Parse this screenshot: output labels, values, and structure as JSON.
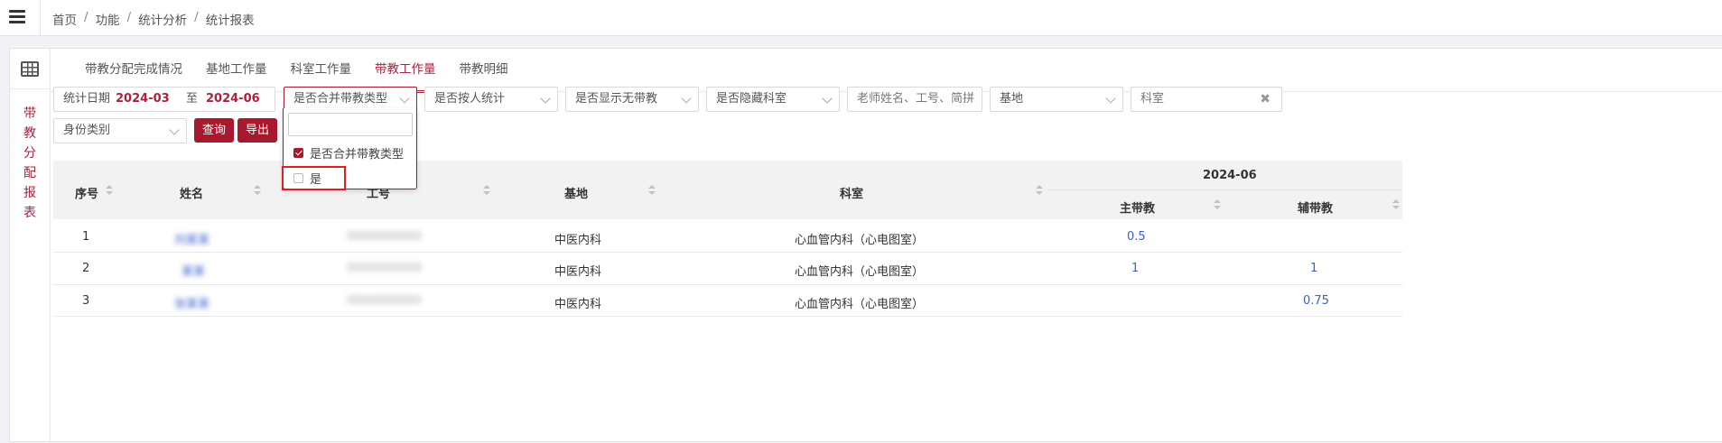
{
  "breadcrumb": [
    "首页",
    "功能",
    "统计分析",
    "统计报表"
  ],
  "sidebar_title": "带教分配报表",
  "tabs": [
    {
      "label": "带教分配完成情况",
      "active": false
    },
    {
      "label": "基地工作量",
      "active": false
    },
    {
      "label": "科室工作量",
      "active": false
    },
    {
      "label": "带教工作量",
      "active": true
    },
    {
      "label": "带教明细",
      "active": false
    }
  ],
  "filters": {
    "date_label": "统计日期",
    "date_from": "2024-03",
    "date_to_sep": "至",
    "date_to": "2024-06",
    "merge_type": "是否合并带教类型",
    "by_person": "是否按人统计",
    "show_none": "是否显示无带教",
    "hide_dept": "是否隐藏科室",
    "teacher_placeholder": "老师姓名、工号、简拼",
    "base": "基地",
    "dept": "科室",
    "identity": "身份类别",
    "clear_icon": "✖"
  },
  "buttons": {
    "query": "查询",
    "export": "导出"
  },
  "dropdown": {
    "search_value": "",
    "options": [
      {
        "label": "是否合并带教类型",
        "checked": true
      },
      {
        "label": "是",
        "checked": false
      }
    ]
  },
  "table": {
    "headers": {
      "seq": "序号",
      "name": "姓名",
      "id": "工号",
      "base": "基地",
      "dept": "科室",
      "period": "2024-06",
      "main": "主带教",
      "aux": "辅带教"
    },
    "rows": [
      {
        "seq": "1",
        "name": "刘某某",
        "id": "0000000000",
        "base": "中医内科",
        "dept": "心血管内科（心电图室）",
        "main": "0.5",
        "aux": ""
      },
      {
        "seq": "2",
        "name": "某某",
        "id": "0000000000",
        "base": "中医内科",
        "dept": "心血管内科（心电图室）",
        "main": "1",
        "aux": "1"
      },
      {
        "seq": "3",
        "name": "张某某",
        "id": "0000000000",
        "base": "中医内科",
        "dept": "心血管内科（心电图室）",
        "main": "",
        "aux": "0.75"
      }
    ]
  }
}
